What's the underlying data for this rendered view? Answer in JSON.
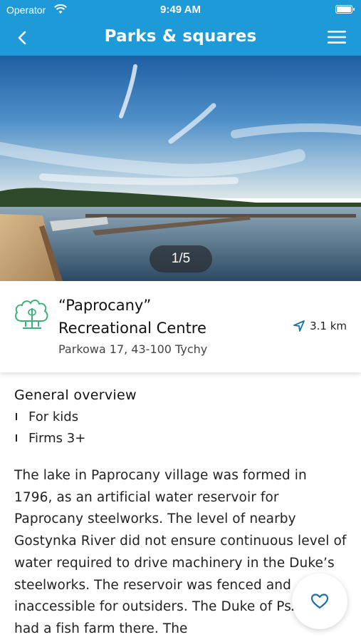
{
  "status_bar": {
    "carrier": "Operator",
    "time": "9:49 AM"
  },
  "nav": {
    "title": "Parks & squares",
    "icons": [
      "chevron-left-icon",
      "hamburger-menu-icon"
    ]
  },
  "gallery": {
    "counter": "1/5"
  },
  "place": {
    "title_line1": "“Paprocany”",
    "title_line2": "Recreational  Centre",
    "address": "Parkowa 17, 43-100 Tychy",
    "distance": "3.1 km",
    "icon": "tree-icon"
  },
  "overview": {
    "title": "General overview",
    "items": [
      "For kids",
      "Firms 3+"
    ]
  },
  "description": "The lake in Paprocany village was formed in 1796, as an artificial water reservoir for Paprocany steelworks. The level of nearby Gostynka River did not ensure continuous level of water required to drive machinery in the Duke’s steelworks. The reservoir was fenced and inaccessible for outsiders. The Duke of Pszczyna had a fish farm there. The",
  "colors": {
    "accent": "#1e9ad8",
    "icon_green": "#3ab07a",
    "heart_blue": "#1e6fa8"
  }
}
